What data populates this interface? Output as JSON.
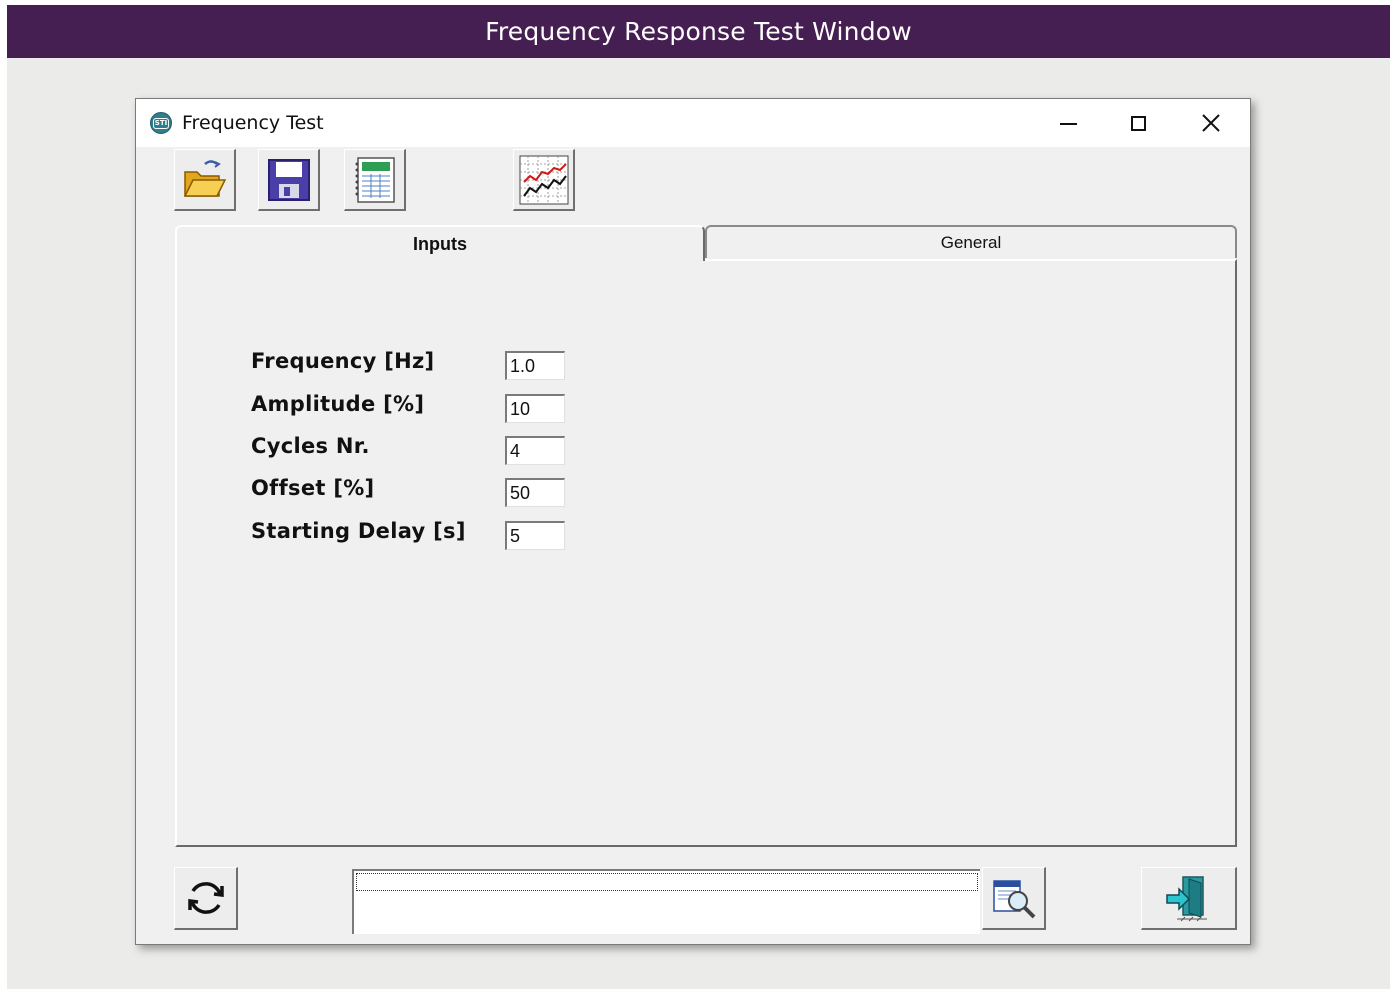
{
  "banner": {
    "title": "Frequency Response Test Window"
  },
  "window": {
    "title": "Frequency Test",
    "app_icon_text": "STI",
    "controls": {
      "minimize": "—",
      "maximize": "☐",
      "close": "✕"
    }
  },
  "toolbar": {
    "buttons": [
      {
        "name": "open-file",
        "icon": "folder-open-icon"
      },
      {
        "name": "save-file",
        "icon": "floppy-disk-icon"
      },
      {
        "name": "spreadsheet",
        "icon": "spreadsheet-icon"
      },
      {
        "name": "chart",
        "icon": "line-chart-icon"
      }
    ]
  },
  "tabs": [
    {
      "label": "Inputs",
      "active": true
    },
    {
      "label": "General",
      "active": false
    }
  ],
  "inputs": {
    "fields": [
      {
        "label": "Frequency [Hz]",
        "value": "1.0"
      },
      {
        "label": "Amplitude [%]",
        "value": "10"
      },
      {
        "label": "Cycles Nr.",
        "value": "4"
      },
      {
        "label": "Offset [%]",
        "value": "50"
      },
      {
        "label": "Starting Delay [s]",
        "value": "5"
      }
    ]
  },
  "bottom": {
    "status_text": "",
    "buttons": [
      {
        "name": "refresh",
        "icon": "refresh-icon"
      },
      {
        "name": "search",
        "icon": "magnifier-icon"
      },
      {
        "name": "exit",
        "icon": "exit-door-icon"
      }
    ]
  },
  "colors": {
    "banner_bg": "#461f52",
    "window_bg": "#f0f0f0",
    "page_bg": "#ebebea"
  }
}
